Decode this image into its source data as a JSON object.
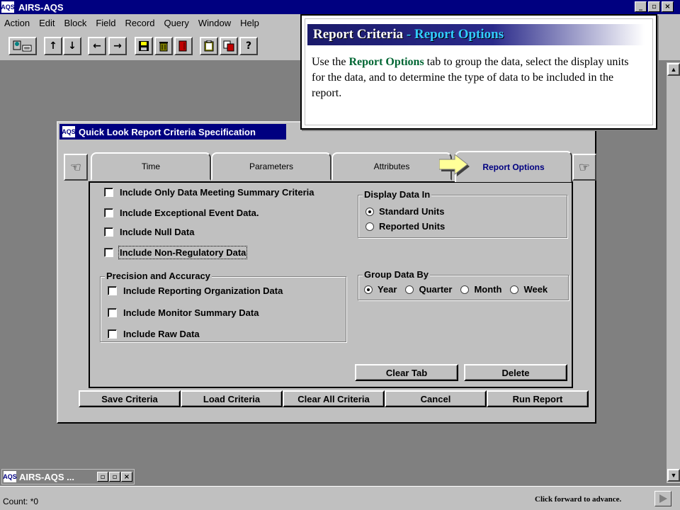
{
  "app": {
    "title": "AIRS-AQS",
    "logo_text": "AQS"
  },
  "window_buttons": {
    "minimize": "_",
    "restore": "▫",
    "close": "×"
  },
  "menu": [
    "Action",
    "Edit",
    "Block",
    "Field",
    "Record",
    "Query",
    "Window",
    "Help"
  ],
  "toolbar": {
    "icons": [
      "enter-query-icon",
      "arrow-up-icon",
      "arrow-down-icon",
      "arrow-left-icon",
      "arrow-right-icon",
      "save-icon",
      "trash-icon",
      "exit-icon",
      "clipboard-icon",
      "copy-icon",
      "help-pointer-icon"
    ],
    "glyphs": {
      "up": "↑",
      "down": "↓",
      "left": "←",
      "right": "→",
      "help": "?"
    }
  },
  "popup": {
    "title_part1": "Report Criteria",
    "title_sep": " - ",
    "title_part2": "Report Options",
    "body_before": "Use the ",
    "body_highlight": "Report Options",
    "body_after": " tab to group the data, select the display units for the data, and to determine the type of data to be included in the report."
  },
  "dialog": {
    "title": "Quick Look Report Criteria Specification",
    "logo_text": "AQS",
    "tabs": [
      {
        "label": "Time",
        "active": false
      },
      {
        "label": "Parameters",
        "active": false
      },
      {
        "label": "Attributes",
        "active": false
      },
      {
        "label": "Report Options",
        "active": true
      }
    ],
    "checkboxes": [
      {
        "label": "Include Only Data Meeting Summary Criteria",
        "checked": false
      },
      {
        "label": "Include Exceptional Event Data.",
        "checked": false
      },
      {
        "label": "Include Null Data",
        "checked": false
      },
      {
        "label": "Include Non-Regulatory Data",
        "checked": false
      }
    ],
    "display_data_in": {
      "title": "Display Data In",
      "options": [
        "Standard Units",
        "Reported Units"
      ],
      "selected": "Standard Units"
    },
    "precision": {
      "title": "Precision and Accuracy",
      "options": [
        "Include Reporting Organization Data",
        "Include Monitor Summary Data",
        "Include Raw Data"
      ]
    },
    "group_by": {
      "title": "Group Data By",
      "options": [
        "Year",
        "Quarter",
        "Month",
        "Week"
      ],
      "selected": "Year"
    },
    "panel_buttons": [
      "Clear Tab",
      "Delete"
    ],
    "bottom_buttons": [
      "Save Criteria",
      "Load Criteria",
      "Clear All Criteria",
      "Cancel",
      "Run Report"
    ]
  },
  "minimized": {
    "title": "AIRS-AQS ...",
    "logo_text": "AQS"
  },
  "status": {
    "count": "Count: *0",
    "forward_hint": "Click forward to advance."
  }
}
